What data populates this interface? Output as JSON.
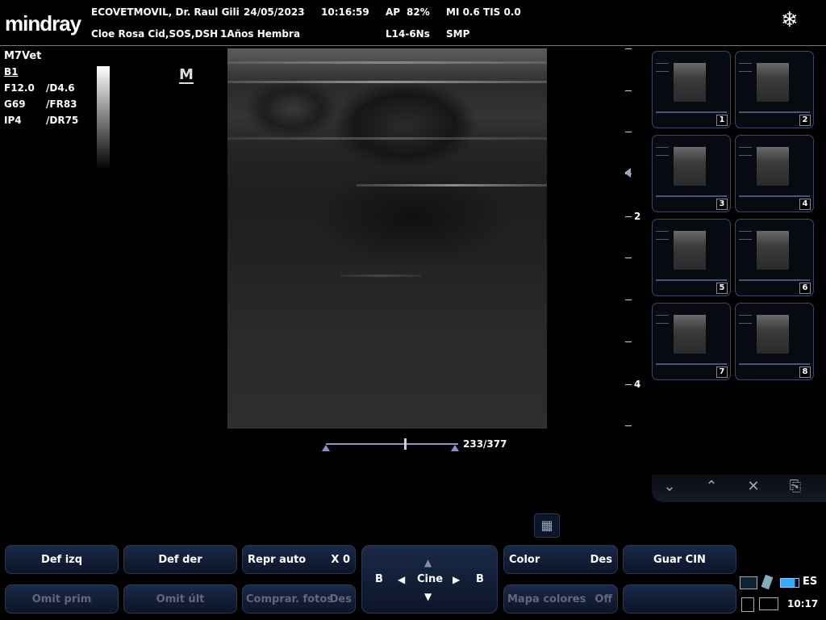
{
  "header": {
    "brand": "mindray",
    "institution": "ECOVETMOVIL, Dr. Raul Gili",
    "date": "24/05/2023",
    "time": "10:16:59",
    "ap": "AP",
    "ap_value": "82%",
    "mi_tis": "MI 0.6 TIS 0.0",
    "patient": "Cloe Rosa Cid,SOS,DSH",
    "patient_info": "1Años Hembra",
    "probe": "L14-6Ns",
    "exam": "SMP",
    "freeze_icon": "snowflake-icon"
  },
  "params": {
    "app": "M7Vet",
    "mode": "B1",
    "freq": "F12.0",
    "depth": "/D4.6",
    "gain": "G69",
    "frame_rate": "/FR83",
    "ip": "IP4",
    "dyn_range": "/DR75",
    "mark": "M"
  },
  "depth_scale": {
    "label_2": "2",
    "label_4": "4"
  },
  "cine": {
    "frame_counter": "233/377"
  },
  "thumbnails": {
    "n1": "1",
    "n2": "2",
    "n3": "3",
    "n4": "4",
    "n5": "5",
    "n6": "6",
    "n7": "7",
    "n8": "8"
  },
  "softkeys": {
    "def_izq": "Def izq",
    "def_der": "Def der",
    "repr_auto": "Repr auto",
    "repr_auto_val": "X 0",
    "omit_prim": "Omit prim",
    "omit_ult": "Omit últ",
    "comprar": "Comprar. fotos",
    "comprar_val": "Des",
    "cine_label": "Cine",
    "b_left": "B",
    "b_right": "B",
    "color": "Color",
    "color_val": "Des",
    "mapa": "Mapa colores",
    "mapa_val": "Off",
    "guar_cin": "Guar CIN"
  },
  "tray": {
    "lang": "ES",
    "clock": "10:17"
  }
}
